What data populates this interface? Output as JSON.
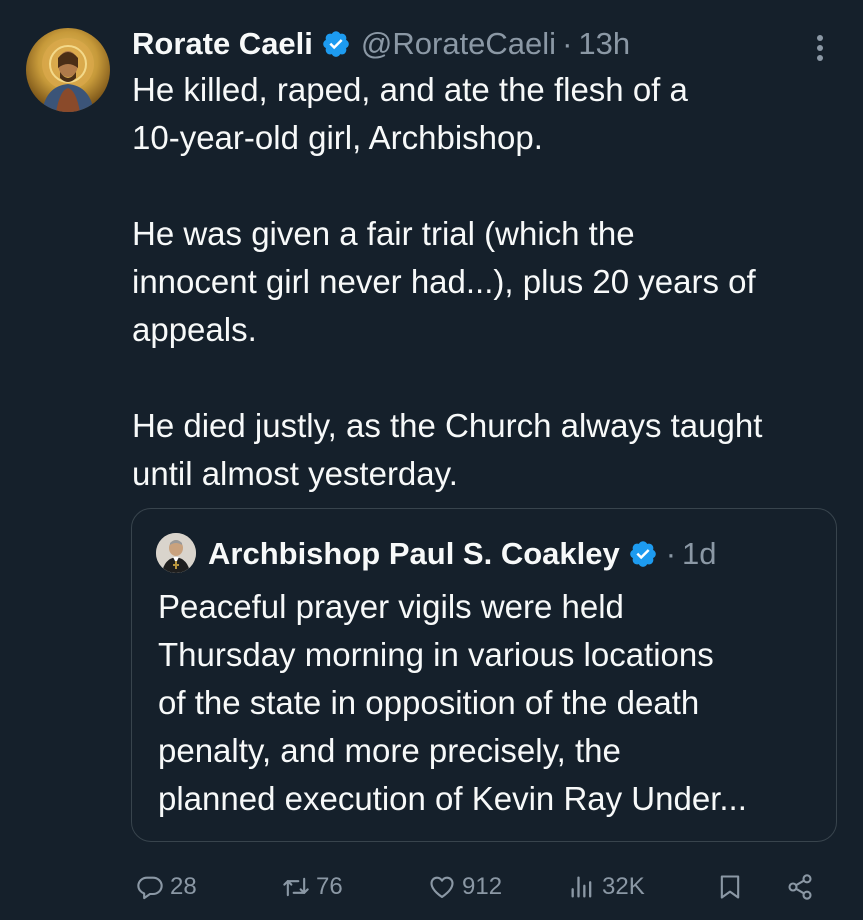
{
  "tweet": {
    "display_name": "Rorate Caeli",
    "handle": "@RorateCaeli",
    "separator": "·",
    "time": "13h",
    "body_lines": [
      "He killed, raped, and ate the flesh of a",
      "10-year-old girl, Archbishop.",
      "",
      "He was given a fair trial (which the",
      "innocent girl never had...), plus 20 years of",
      "appeals.",
      "",
      "He died justly, as the Church always taught",
      "until almost yesterday."
    ]
  },
  "quote": {
    "display_name": "Archbishop Paul S. Coakley",
    "separator": "·",
    "time": "1d",
    "body_lines": [
      "Peaceful prayer vigils were held",
      "Thursday morning in various locations",
      "of the state in opposition of the death",
      "penalty, and more precisely, the",
      "planned execution of Kevin Ray Under..."
    ]
  },
  "actions": {
    "replies": "28",
    "retweets": "76",
    "likes": "912",
    "views": "32K"
  },
  "icons": {
    "verified": "verified-badge-icon",
    "more": "more-options-icon",
    "reply": "reply-icon",
    "retweet": "retweet-icon",
    "like": "heart-icon",
    "views": "views-icon",
    "bookmark": "bookmark-icon",
    "share": "share-icon"
  },
  "colors": {
    "background": "#15202b",
    "text": "#f7f9f9",
    "muted": "#8b98a5",
    "border": "#38444d",
    "verified": "#1d9bf0"
  }
}
